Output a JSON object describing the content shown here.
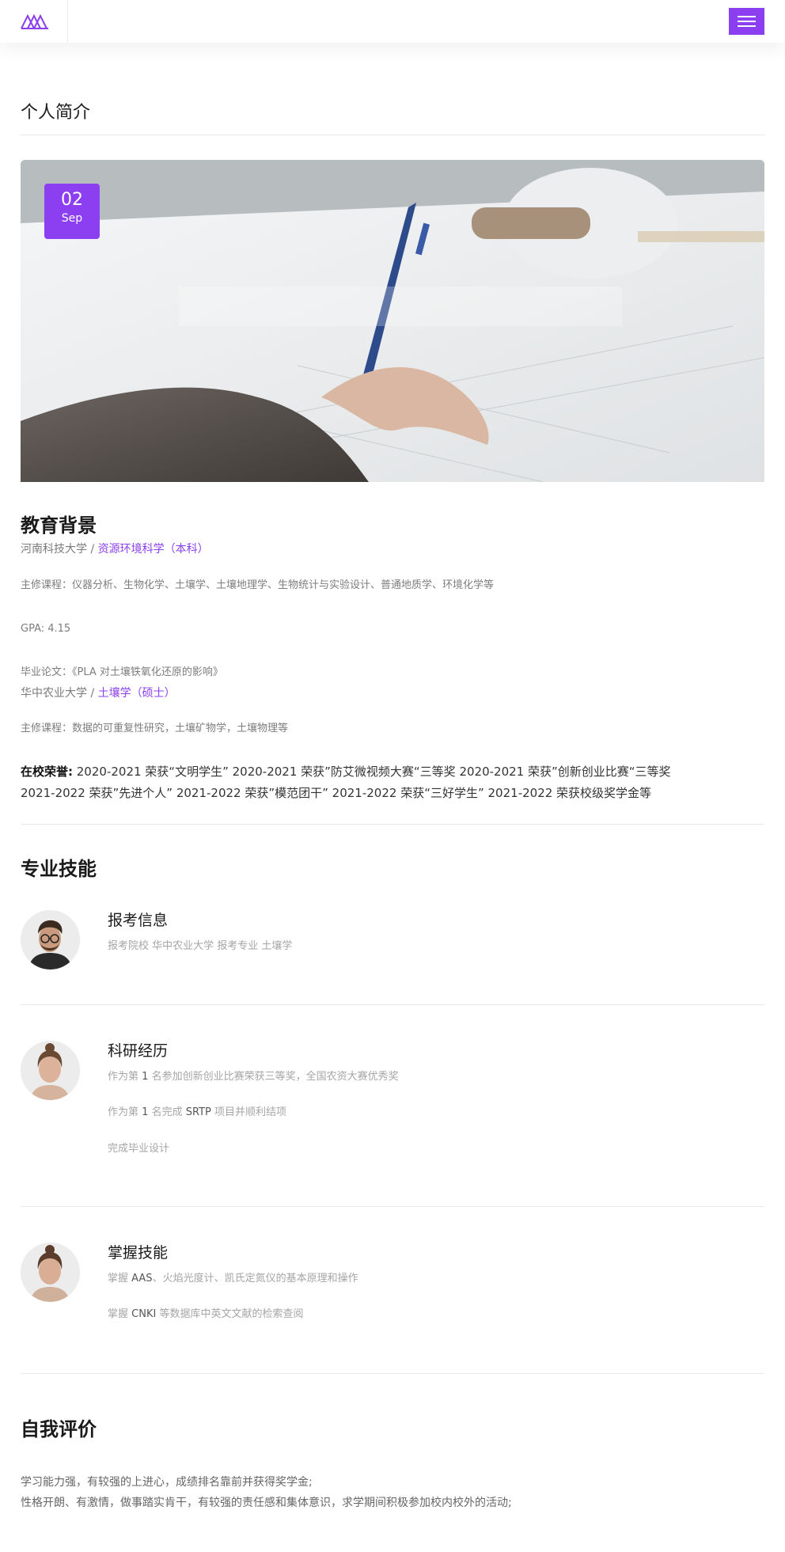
{
  "header": {
    "logo_icon": "mountain-logo-icon",
    "menu_icon": "hamburger-menu-icon",
    "accent_color": "#8b3ff0"
  },
  "intro": {
    "title": "个人简介"
  },
  "hero": {
    "date_day": "02",
    "date_month": "Sep",
    "image_description_icon": "hand-writing-photo"
  },
  "education": {
    "title": "教育背景",
    "school1": "河南科技大学",
    "separator": "/",
    "major1": "资源环境科学（本科）",
    "courses1": "主修课程：仪器分析、生物化学、土壤学、土壤地理学、生物统计与实验设计、普通地质学、环境化学等",
    "gpa": "GPA: 4.15",
    "thesis": "毕业论文：《PLA 对土壤铁氧化还原的影响》",
    "school2": "华中农业大学",
    "major2": "土壤学（硕士）",
    "courses2": "主修课程：数据的可重复性研究，土壤矿物学，土壤物理等",
    "honors_label": "在校荣誉:",
    "honors_line1": " 2020-2021 荣获“文明学生” 2020-2021 荣获”防艾微视频大赛“三等奖 2020-2021 荣获”创新创业比赛“三等奖",
    "honors_line2": "2021-2022 荣获”先进个人” 2021-2022 荣获”模范团干” 2021-2022 荣获“三好学生” 2021-2022 荣获校级奖学金等"
  },
  "skills": {
    "title": "专业技能",
    "items": [
      {
        "title": "报考信息",
        "avatar_icon": "male-glasses-avatar",
        "lines": [
          "报考院校 华中农业大学 报考专业 土壤学"
        ]
      },
      {
        "title": "科研经历",
        "avatar_icon": "female-avatar",
        "line1_pre": "作为第",
        "line1_num": "1",
        "line1_post": "名参加创新创业比赛荣获三等奖，全国农资大赛优秀奖",
        "line2_pre": "作为第",
        "line2_num": "1",
        "line2_mid": "名完成",
        "line2_code": "SRTP",
        "line2_post": "项目并顺利结项",
        "line3": "完成毕业设计"
      },
      {
        "title": "掌握技能",
        "avatar_icon": "female-avatar",
        "line1_pre": "掌握",
        "line1_code": "AAS",
        "line1_post": "、火焰光度计、凯氏定氮仪的基本原理和操作",
        "line2_pre": "掌握",
        "line2_code": "CNKI",
        "line2_post": "等数据库中英文文献的检索查阅"
      }
    ]
  },
  "evaluation": {
    "title": "自我评价",
    "line1": "学习能力强，有较强的上进心，成绩排名靠前并获得奖学金;",
    "line2": "性格开朗、有激情，做事踏实肯干，有较强的责任感和集体意识，求学期间积极参加校内校外的活动;"
  }
}
